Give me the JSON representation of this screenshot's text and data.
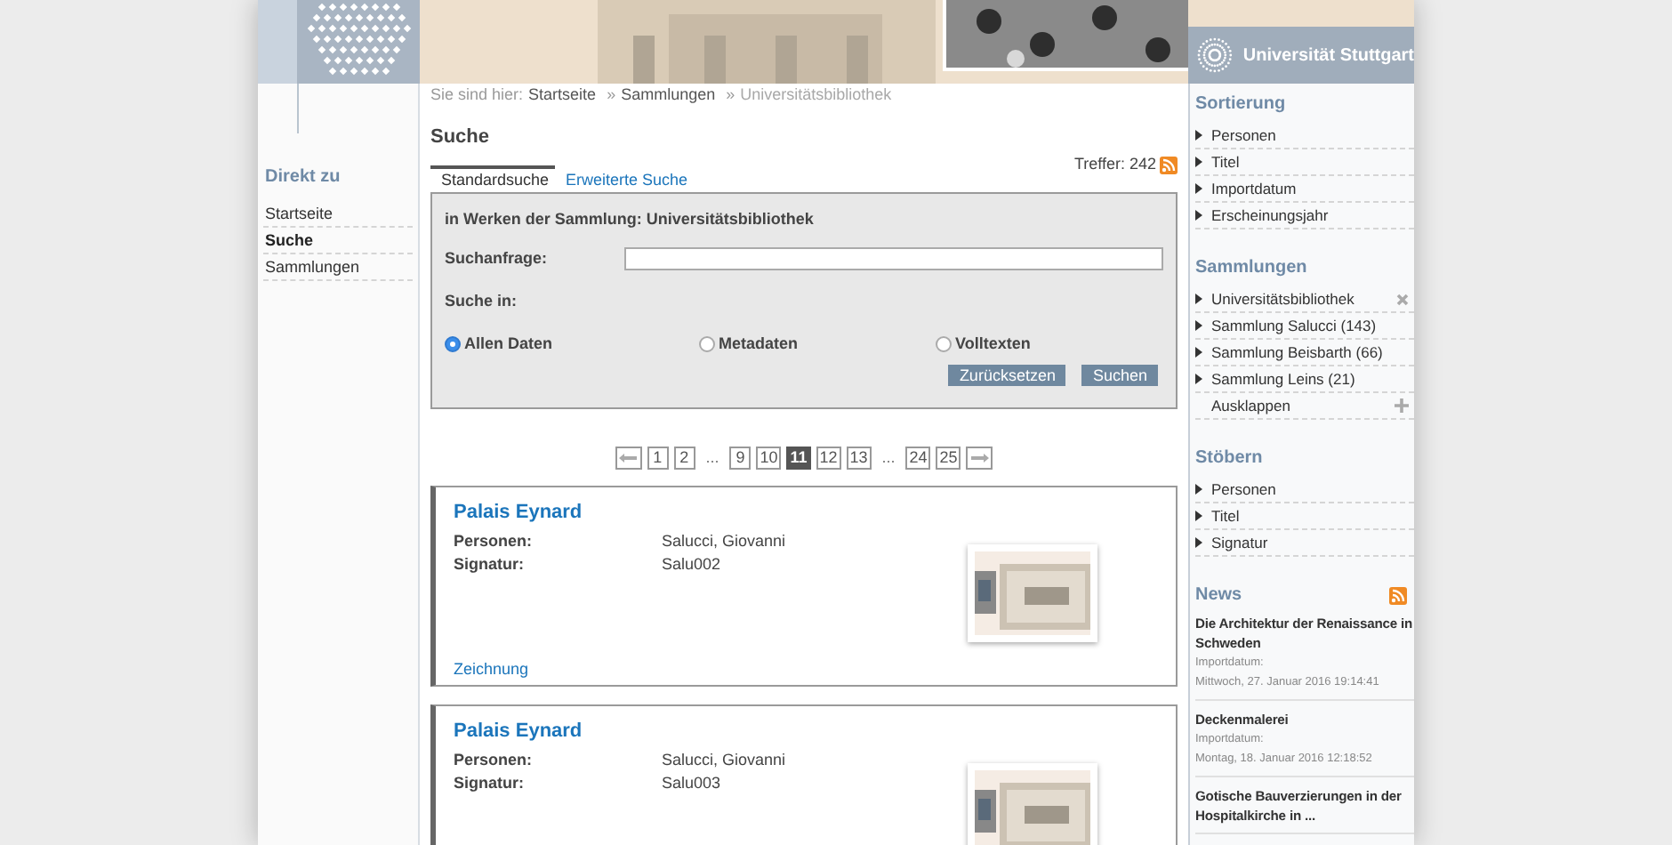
{
  "header": {
    "brand": "Universität Stuttgart"
  },
  "breadcrumb": {
    "label": "Sie sind hier:",
    "items": [
      {
        "text": "Startseite",
        "current": false
      },
      {
        "separator": "»",
        "text": "Sammlungen",
        "current": false
      },
      {
        "separator": "»",
        "text": "Universitätsbibliothek",
        "current": true
      }
    ]
  },
  "left_nav": {
    "title": "Direkt zu",
    "items": [
      {
        "label": "Startseite",
        "selected": false
      },
      {
        "label": "Suche",
        "selected": true
      },
      {
        "label": "Sammlungen",
        "selected": false
      }
    ]
  },
  "main": {
    "title": "Suche",
    "hits": "Treffer: 242",
    "tabs": [
      {
        "label": "Standardsuche",
        "selected": true
      },
      {
        "label": "Erweiterte Suche",
        "selected": false
      }
    ],
    "form": {
      "heading": "in Werken der Sammlung: Universitätsbibliothek",
      "query_label": "Suchanfrage:",
      "scope_label": "Suche in:",
      "scopes": [
        {
          "label": "Allen Daten",
          "selected": true
        },
        {
          "label": "Metadaten",
          "selected": false
        },
        {
          "label": "Volltexten",
          "selected": false
        }
      ],
      "buttons": [
        "Zurücksetzen",
        "Suchen"
      ]
    },
    "pagination": [
      {
        "kind": "prev"
      },
      {
        "kind": "page",
        "label": "1",
        "selected": false
      },
      {
        "kind": "page",
        "label": "2",
        "selected": false
      },
      {
        "kind": "ellipsis",
        "label": "..."
      },
      {
        "kind": "page",
        "label": "9",
        "selected": false
      },
      {
        "kind": "page",
        "label": "10",
        "selected": false
      },
      {
        "kind": "page",
        "label": "11",
        "selected": true
      },
      {
        "kind": "page",
        "label": "12",
        "selected": false
      },
      {
        "kind": "page",
        "label": "13",
        "selected": false
      },
      {
        "kind": "ellipsis",
        "label": "..."
      },
      {
        "kind": "page",
        "label": "24",
        "selected": false
      },
      {
        "kind": "page",
        "label": "25",
        "selected": false
      },
      {
        "kind": "next"
      }
    ],
    "results": [
      {
        "title": "Palais Eynard",
        "fields": [
          {
            "label": "Personen:",
            "value": "Salucci, Giovanni"
          },
          {
            "label": "Signatur:",
            "value": "Salu002"
          }
        ],
        "type": "Zeichnung"
      },
      {
        "title": "Palais Eynard",
        "fields": [
          {
            "label": "Personen:",
            "value": "Salucci, Giovanni"
          },
          {
            "label": "Signatur:",
            "value": "Salu003"
          }
        ]
      }
    ]
  },
  "sidebar": {
    "sections": [
      {
        "kind": "list",
        "title": "Sortierung",
        "items": [
          {
            "label": "Personen"
          },
          {
            "label": "Titel"
          },
          {
            "label": "Importdatum"
          },
          {
            "label": "Erscheinungsjahr"
          }
        ]
      },
      {
        "kind": "list",
        "title": "Sammlungen",
        "items": [
          {
            "label": "Universitätsbibliothek",
            "kind": "removable"
          },
          {
            "label": "Sammlung Salucci (143)"
          },
          {
            "label": "Sammlung Beisbarth (66)"
          },
          {
            "label": "Sammlung Leins (21)"
          },
          {
            "label": "Ausklappen",
            "kind": "expander"
          }
        ]
      },
      {
        "kind": "list",
        "title": "Stöbern",
        "items": [
          {
            "label": "Personen"
          },
          {
            "label": "Titel"
          },
          {
            "label": "Signatur"
          }
        ]
      },
      {
        "kind": "news",
        "title": "News",
        "items": [
          {
            "title": "Die Architektur der Renaissance in Schweden",
            "date_label": "Importdatum:",
            "date": "Mittwoch, 27. Januar 2016 19:14:41"
          },
          {
            "title": "Deckenmalerei",
            "date_label": "Importdatum:",
            "date": "Montag, 18. Januar 2016 12:18:52"
          },
          {
            "title": "Gotische Bauverzierungen in der Hospitalkirche in ..."
          }
        ]
      }
    ]
  }
}
